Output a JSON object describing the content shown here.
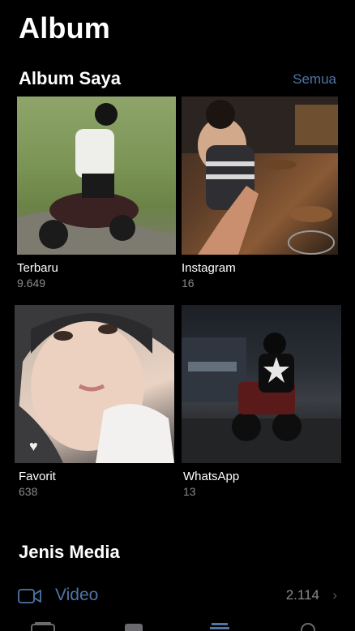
{
  "header": {
    "title": "Album"
  },
  "my_albums": {
    "title": "Album Saya",
    "see_all": "Semua",
    "albums": [
      {
        "name": "Terbaru",
        "count": "9.649"
      },
      {
        "name": "Instagram",
        "count": "16"
      },
      {
        "name": "Favorit",
        "count": "638"
      },
      {
        "name": "WhatsApp",
        "count": "13"
      }
    ]
  },
  "media_types": {
    "title": "Jenis Media",
    "items": [
      {
        "label": "Video",
        "count": "2.114",
        "icon": "video-icon"
      }
    ]
  },
  "colors": {
    "accent": "#4e75a6",
    "secondary_text": "#8a8a8e",
    "background": "#000000"
  },
  "tabbar": {
    "icons": [
      "photos-tab-icon",
      "for-you-tab-icon",
      "albums-tab-icon",
      "search-tab-icon"
    ]
  }
}
